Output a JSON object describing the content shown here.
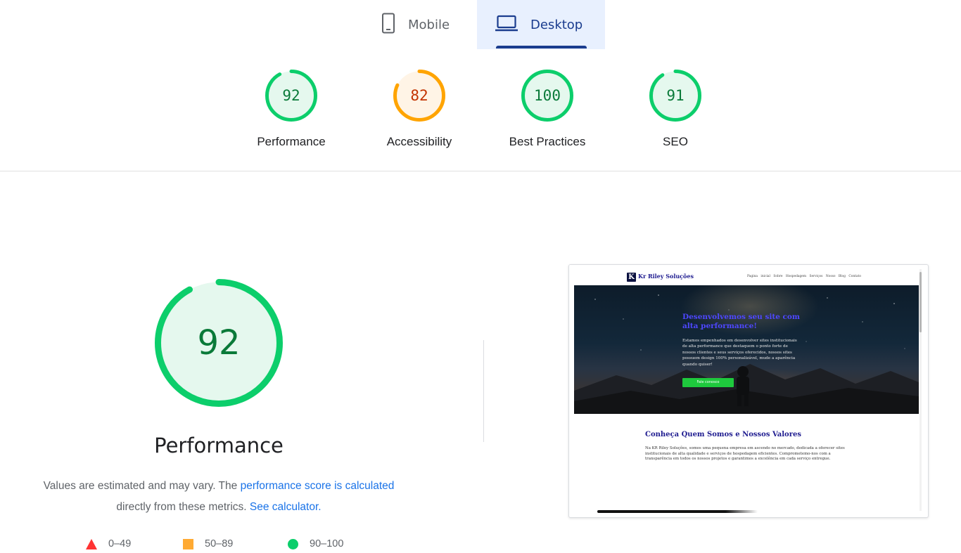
{
  "tabs": [
    {
      "label": "Mobile",
      "icon": "phone-icon",
      "selected": false
    },
    {
      "label": "Desktop",
      "icon": "laptop-icon",
      "selected": true
    }
  ],
  "categories": [
    {
      "score": "92",
      "label": "Performance",
      "rating": "pass"
    },
    {
      "score": "82",
      "label": "Accessibility",
      "rating": "average"
    },
    {
      "score": "100",
      "label": "Best Practices",
      "rating": "pass"
    },
    {
      "score": "91",
      "label": "SEO",
      "rating": "pass"
    }
  ],
  "performance": {
    "score": "92",
    "title": "Performance",
    "description_prefix": "Values are estimated and may vary. The ",
    "score_link": "performance score is calculated",
    "description_middle": " directly from these metrics. ",
    "calculator_link": "See calculator."
  },
  "legend": [
    {
      "shape": "triangle",
      "range": "0–49",
      "color": "#ff3333"
    },
    {
      "shape": "square",
      "range": "50–89",
      "color": "#ffaa33"
    },
    {
      "shape": "circle",
      "range": "90–100",
      "color": "#0cce6b"
    }
  ],
  "colors": {
    "pass": "#0cce6b",
    "pass_text": "#0a7a39",
    "average": "#ffa400",
    "average_text": "#c33300",
    "tab_active_bg": "#e8f0fe",
    "tab_active_text": "#1a3c8e",
    "link": "#1a73e8"
  },
  "screenshot": {
    "logo_letter": "K",
    "brand": "Kr Riley Soluções",
    "nav_links": [
      "Pagina inicial",
      "Sobre",
      "Hospedagem",
      "Serviços",
      "Nosso Blog",
      "Contato"
    ],
    "hero_title": "Desenvolvemos seu site com alta performance!",
    "hero_text": "Estamos empenhados em desenvolver sites institucionais de alta performance que destaquem o ponto forte de nossos clientes e seus serviços oferecidos, nossos sites possuem design 100% personalizável, mude a aparência quando quiser!",
    "hero_button": "Fale conosco",
    "section_title": "Conheça Quem Somos e Nossos Valores",
    "section_text": "Na KR Riley Soluções, somos uma pequena empresa em ascendo no mercado, dedicada a oferecer sites institucionais de alta qualidade e serviços de hospedagem eficientes. Comprometemo-nos com a transparência em todos os nossos projetos e garantimos a excelência em cada serviço entregue."
  }
}
